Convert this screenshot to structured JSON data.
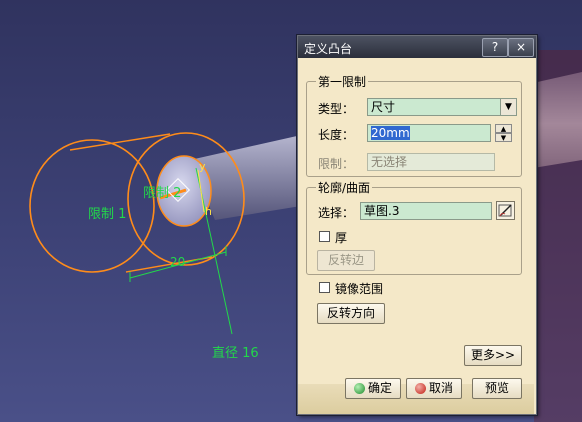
{
  "viewport": {
    "labels": {
      "limit_1": "限制 1",
      "limit_2": "限制 2",
      "diameter": "直径 16",
      "dimension": "20",
      "axis_y": "y",
      "axis_h": "h"
    },
    "colors": {
      "background": "#3d4276",
      "shaft": "#a6a6c0",
      "outline": "#ff8c1a",
      "label": "#22d84a"
    }
  },
  "dialog": {
    "title": "定义凸台",
    "titlebar_buttons": {
      "help": "?",
      "close": "×"
    },
    "first_limit": {
      "group_title": "第一限制",
      "type_label": "类型：",
      "type_value": "尺寸",
      "length_label": "长度：",
      "length_value": "20mm",
      "limit_label": "限制：",
      "limit_value": "无选择"
    },
    "profile": {
      "group_title": "轮廓/曲面",
      "selection_label": "选择：",
      "selection_value": "草图.3",
      "sketch_button_icon": "sketch-edit-icon",
      "thick_label": "厚",
      "thick_checked": false,
      "reverse_side_button": "反转边"
    },
    "mirror_label": "镜像范围",
    "mirror_checked": false,
    "reverse_direction_button": "反转方向",
    "more_button": "更多>>",
    "ok_button": "确定",
    "cancel_button": "取消",
    "preview_button": "预览"
  }
}
